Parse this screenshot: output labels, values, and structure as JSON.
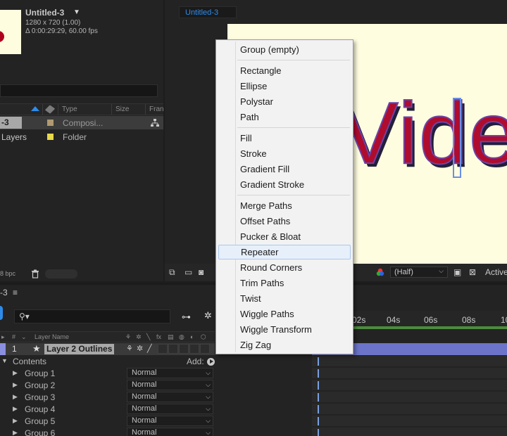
{
  "project": {
    "comp_name": "Untitled-3",
    "comp_resolution": "1280 x 720 (1.00)",
    "comp_duration": "Δ 0:00:29:29, 60.00 fps",
    "headers": {
      "type": "Type",
      "size": "Size",
      "frame": "Fran"
    },
    "items": [
      {
        "name": "-3",
        "type": "Composi...",
        "color": "#b09a70"
      },
      {
        "name": "Layers",
        "type": "Folder",
        "color": "#e8d84a"
      }
    ],
    "bpc": "8 bpc"
  },
  "viewer": {
    "tab": "Untitled-3",
    "canvas_text": "Vide",
    "resolution": "(Half)",
    "camera": "Active"
  },
  "timeline": {
    "tab": "-3",
    "menu_glyph": "≡",
    "search_glyph": "⚲▾",
    "head": {
      "num": "#",
      "layer_name": "Layer Name",
      "fx": "fx"
    },
    "layer": {
      "number": "1",
      "name": "Layer 2 Outlines"
    },
    "contents_label": "Contents",
    "add_label": "Add:",
    "groups": [
      {
        "name": "Group 1",
        "mode": "Normal"
      },
      {
        "name": "Group 2",
        "mode": "Normal"
      },
      {
        "name": "Group 3",
        "mode": "Normal"
      },
      {
        "name": "Group 4",
        "mode": "Normal"
      },
      {
        "name": "Group 5",
        "mode": "Normal"
      },
      {
        "name": "Group 6",
        "mode": "Normal"
      }
    ],
    "ruler_ticks": [
      "02s",
      "04s",
      "06s",
      "08s",
      "10"
    ]
  },
  "context_menu": {
    "items": [
      "Group (empty)",
      "Rectangle",
      "Ellipse",
      "Polystar",
      "Path",
      "Fill",
      "Stroke",
      "Gradient Fill",
      "Gradient Stroke",
      "Merge Paths",
      "Offset Paths",
      "Pucker & Bloat",
      "Repeater",
      "Round Corners",
      "Trim Paths",
      "Twist",
      "Wiggle Paths",
      "Wiggle Transform",
      "Zig Zag"
    ],
    "highlighted": "Repeater"
  },
  "colors": {
    "accent": "#2d8ceb",
    "layer_bar": "#6b74c8",
    "canvas": "#fffde0",
    "text_fill": "#b00c2d",
    "text_stroke": "#6a44a8"
  }
}
